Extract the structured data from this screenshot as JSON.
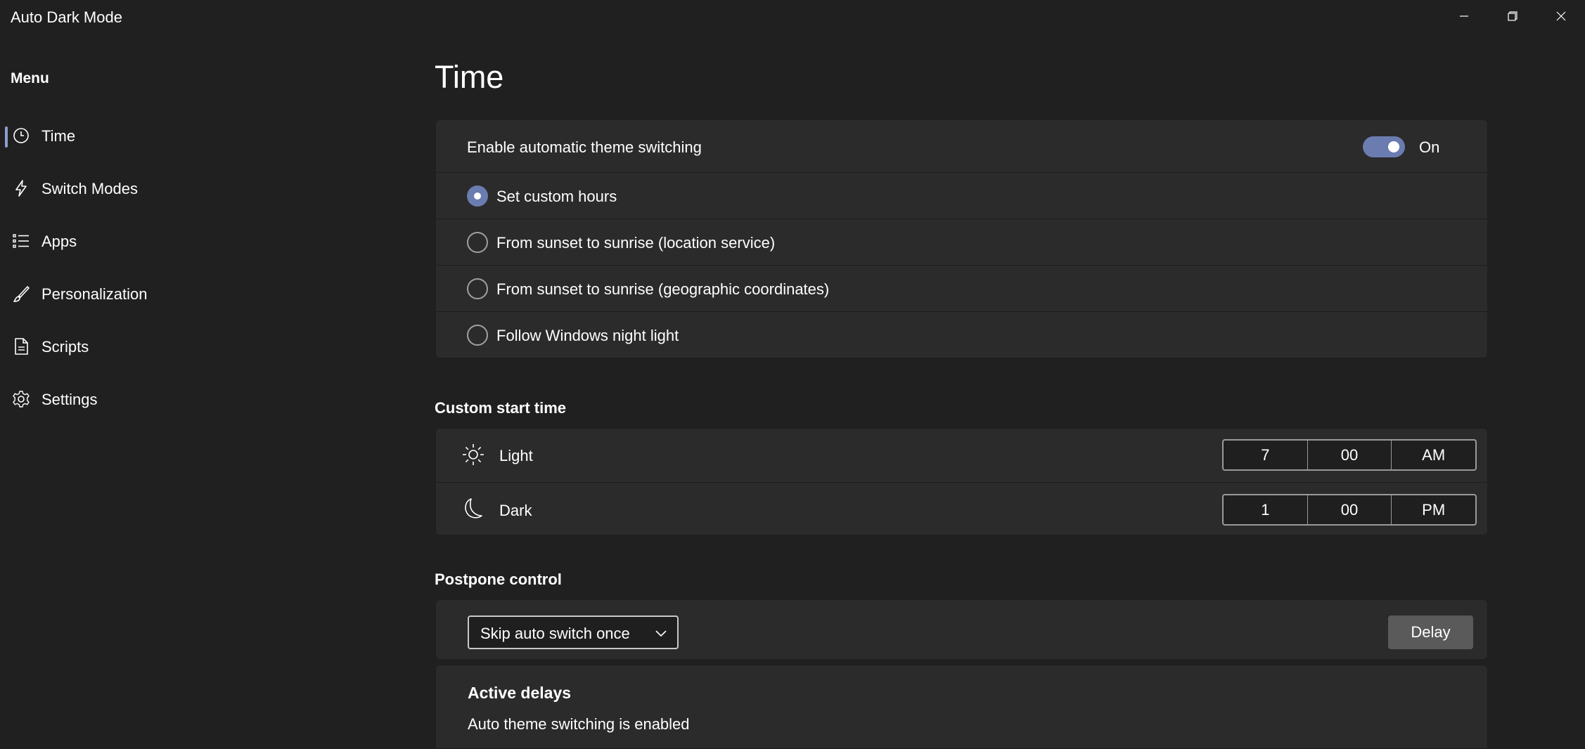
{
  "window": {
    "title": "Auto Dark Mode"
  },
  "sidebar": {
    "menu_title": "Menu",
    "items": [
      {
        "label": "Time",
        "icon": "clock-icon",
        "selected": true
      },
      {
        "label": "Switch Modes",
        "icon": "lightning-icon",
        "selected": false
      },
      {
        "label": "Apps",
        "icon": "list-icon",
        "selected": false
      },
      {
        "label": "Personalization",
        "icon": "brush-icon",
        "selected": false
      },
      {
        "label": "Scripts",
        "icon": "document-icon",
        "selected": false
      },
      {
        "label": "Settings",
        "icon": "gear-icon",
        "selected": false
      }
    ]
  },
  "main": {
    "page_title": "Time",
    "switching": {
      "label": "Enable automatic theme switching",
      "toggle_state": "On",
      "options": [
        {
          "label": "Set custom hours",
          "checked": true
        },
        {
          "label": "From sunset to sunrise (location service)",
          "checked": false
        },
        {
          "label": "From sunset to sunrise (geographic coordinates)",
          "checked": false
        },
        {
          "label": "Follow Windows night light",
          "checked": false
        }
      ]
    },
    "custom_start": {
      "title": "Custom start time",
      "light": {
        "label": "Light",
        "hour": "7",
        "minute": "00",
        "period": "AM"
      },
      "dark": {
        "label": "Dark",
        "hour": "1",
        "minute": "00",
        "period": "PM"
      }
    },
    "postpone": {
      "title": "Postpone control",
      "dropdown_value": "Skip auto switch once",
      "delay_button": "Delay",
      "active_title": "Active delays",
      "active_text": "Auto theme switching is enabled"
    }
  },
  "colors": {
    "background": "#202020",
    "card": "#2b2b2b",
    "accent": "#6a7cb0",
    "nav_indicator": "#8c9ecd"
  }
}
